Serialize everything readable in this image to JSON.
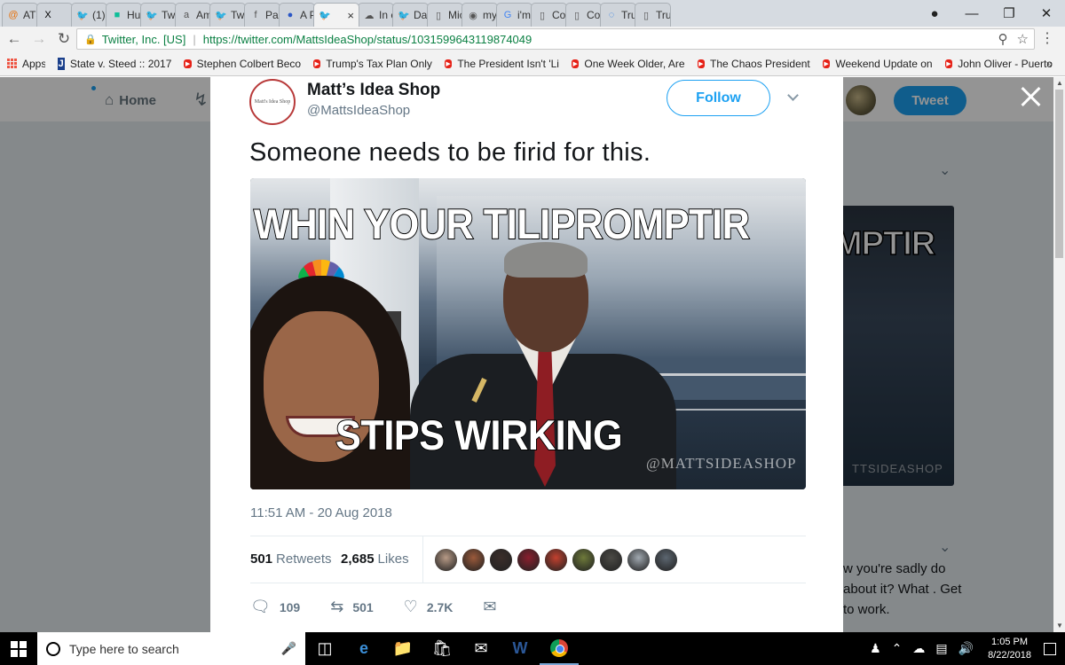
{
  "browser": {
    "tabs": [
      {
        "title": "AT&",
        "icon": "at-icon"
      },
      {
        "title": "",
        "icon": "x-icon"
      },
      {
        "title": "(1)",
        "icon": "twitter-icon"
      },
      {
        "title": "Huf",
        "icon": "huffpost-icon"
      },
      {
        "title": "Twi",
        "icon": "twitter-icon"
      },
      {
        "title": "Am",
        "icon": "amazon-icon"
      },
      {
        "title": "Twi",
        "icon": "twitter-icon"
      },
      {
        "title": "Pau",
        "icon": "facebook-icon"
      },
      {
        "title": "A P",
        "icon": "dot-icon"
      },
      {
        "title": "",
        "icon": "twitter-icon"
      },
      {
        "title": "In c",
        "icon": "cloud-icon"
      },
      {
        "title": "Dav",
        "icon": "twitter-icon"
      },
      {
        "title": "Mic",
        "icon": "document-icon"
      },
      {
        "title": "my",
        "icon": "site-icon"
      },
      {
        "title": "i'm",
        "icon": "google-icon"
      },
      {
        "title": "Col",
        "icon": "document-icon"
      },
      {
        "title": "Col",
        "icon": "document-icon"
      },
      {
        "title": "Tru",
        "icon": "loading-icon"
      },
      {
        "title": "Tru",
        "icon": "document-icon"
      }
    ],
    "site_identity": "Twitter, Inc. [US]",
    "url": "https://twitter.com/MattsIdeaShop/status/1031599643119874049",
    "bookmarks": [
      {
        "label": "Apps",
        "type": "apps"
      },
      {
        "label": "State v. Steed :: 2017",
        "type": "j"
      },
      {
        "label": "Stephen Colbert Beco",
        "type": "youtube"
      },
      {
        "label": "Trump's Tax Plan Only",
        "type": "youtube"
      },
      {
        "label": "The President Isn't 'Li",
        "type": "youtube"
      },
      {
        "label": "One Week Older, Are",
        "type": "youtube"
      },
      {
        "label": "The Chaos President",
        "type": "youtube"
      },
      {
        "label": "Weekend Update on",
        "type": "youtube"
      },
      {
        "label": "John Oliver - Puerto",
        "type": "youtube"
      }
    ]
  },
  "twitter": {
    "nav_home": "Home",
    "tweet_button": "Tweet",
    "background_text": "w you're sadly do about it? What . Get to work.",
    "background_image_text": "MPTIR",
    "background_watermark": "TTSIDEASHOP"
  },
  "tweet": {
    "avatar_text": "Matt's Idea Shop",
    "display_name": "Matt’s Idea Shop",
    "handle": "@MattsIdeaShop",
    "follow_label": "Follow",
    "text": "Someone needs to be firid for this.",
    "meme_top": "WHIN YOUR TILIPROMPTIR",
    "meme_bottom": "STIPS WIRKING",
    "meme_watermark": "@MATTSIDEASHOP",
    "timestamp": "11:51 AM - 20 Aug 2018",
    "retweets_count": "501",
    "retweets_label": "Retweets",
    "likes_count": "2,685",
    "likes_label": "Likes",
    "liker_colors": [
      "#b79a86",
      "#9b5a3b",
      "#3b2e2a",
      "#8a1e2e",
      "#c3412f",
      "#6e7a3a",
      "#4b4a45",
      "#a0a8b0",
      "#5c6670"
    ],
    "reply_count": "109",
    "retweet_action_count": "501",
    "like_action_count": "2.7K"
  },
  "taskbar": {
    "search_placeholder": "Type here to search",
    "time": "1:05 PM",
    "date": "8/22/2018"
  },
  "colors": {
    "twitter_blue": "#1da1f2",
    "secure_green": "#0b8043"
  }
}
